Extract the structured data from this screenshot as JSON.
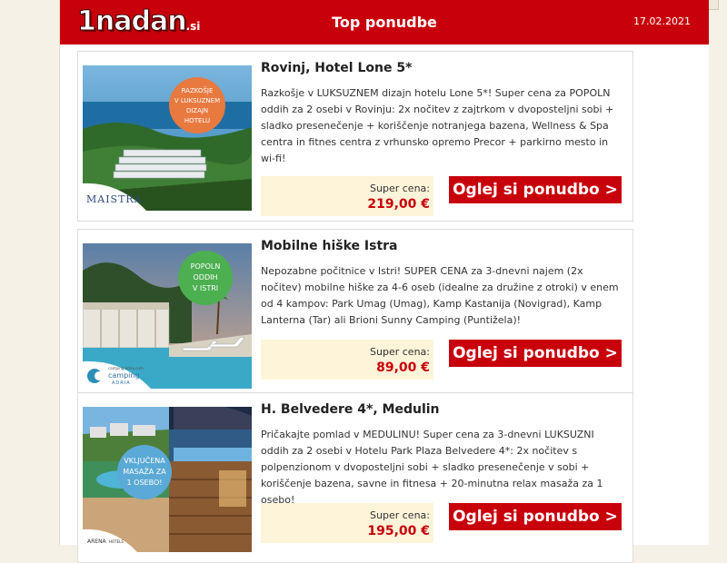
{
  "header": {
    "logo_main": "1nadan",
    "logo_domain": ".si",
    "title": "Top ponudbe",
    "date": "17.02.2021",
    "background": "#c8000b"
  },
  "offers": [
    {
      "title": "Rovinj, Hotel Lone 5*",
      "description": "Razkošje v LUKSUZNEM dizajn hotelu Lone 5*! Super cena za POPOLN oddih za 2 osebi v Rovinju: 2x nočitev z zajtrkom v dvoposteljni sobi + sladko presenečenje + koriščenje notranjega bazena, Wellness & Spa centra in fitnes centra z vrhunsko opremo Precor + parkirno mesto in wi-fi!",
      "price_label": "Super cena:",
      "price": "219,00 €",
      "button": "Oglej si ponudbo >",
      "badge_lines": [
        "RAZKOŠJE",
        "V LUKSUZNEM",
        "DIZAJN",
        "HOTELU"
      ],
      "brand": "MAISTRA",
      "badge_color": "#e8793f"
    },
    {
      "title": "Mobilne hiške Istra",
      "description": "Nepozabne počitnice v Istri! SUPER CENA za 3-dnevni najem (2x nočitev) mobilne hiške za 4-6 oseb (idealne za družine z otroki) v enem od 4 kampov: Park Umag (Umag), Kamp Kastanija (Novigrad), Kamp Lanterna (Tar) ali Brioni Sunny Camping (Puntižela)!",
      "price_label": "Super cena:",
      "price": "89,00 €",
      "button": "Oglej si ponudbo >",
      "badge_lines": [
        "POPOLN",
        "ODDIH",
        "V ISTRI"
      ],
      "brand_small": "camping-adria.com",
      "brand": "camping",
      "brand_sub": "ADRIA",
      "badge_color": "#4caf50"
    },
    {
      "title": "H. Belvedere 4*, Medulin",
      "description": "Pričakajte pomlad v MEDULINU! Super cena za 3-dnevni LUKSUZNI oddih za 2 osebi v Hotelu Park Plaza Belvedere 4*: 2x nočitev s polpenzionom v dvoposteljni sobi + sladko presenečenje v sobi + koriščenje bazena, savne in fitnesa + 20-minutna relax masaža za 1 osebo!",
      "price_label": "Super cena:",
      "price": "195,00 €",
      "button": "Oglej si ponudbo >",
      "badge_lines": [
        "VKLJUČENA",
        "MASAŽA ZA",
        "1 OSEBO!"
      ],
      "brand": "ARENA",
      "brand_sub": "HOTELS",
      "badge_color": "#5aa9d6"
    }
  ]
}
